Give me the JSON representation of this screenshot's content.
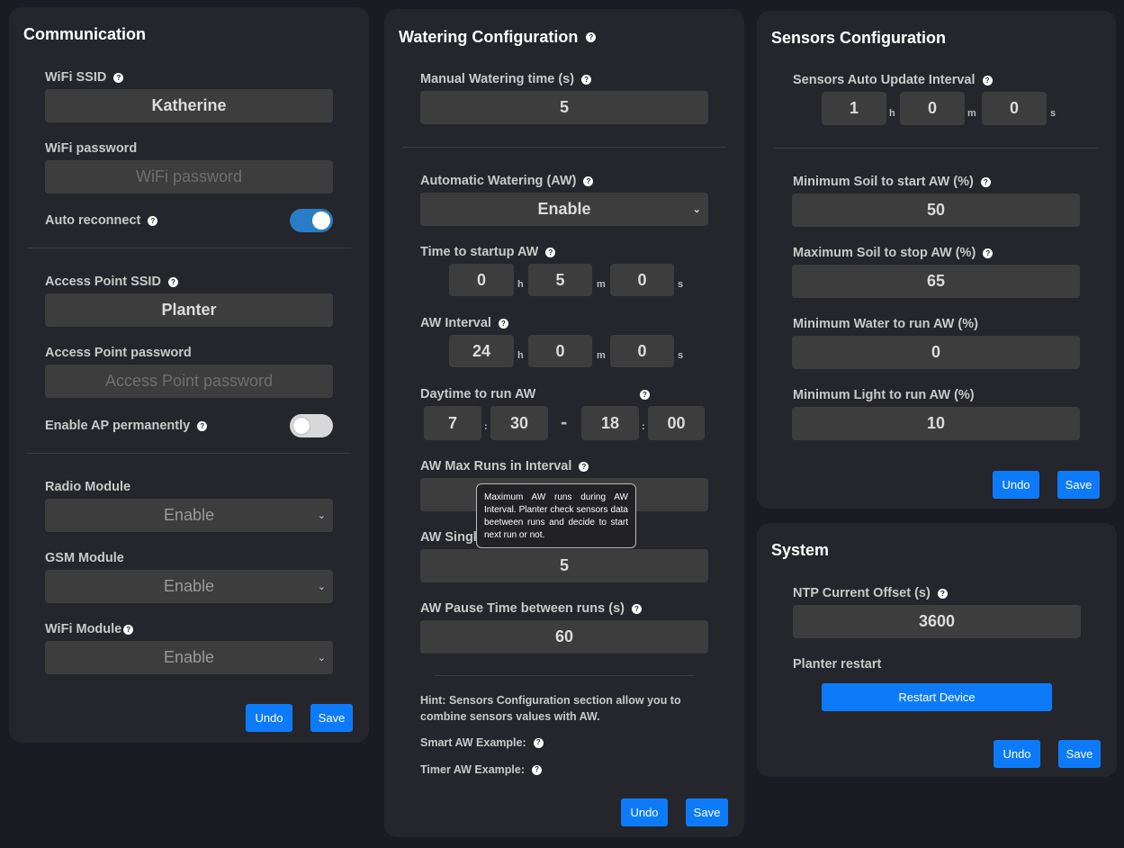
{
  "communication": {
    "title": "Communication",
    "wifi_ssid_label": "WiFi SSID",
    "wifi_ssid": "Katherine",
    "wifi_password_label": "WiFi password",
    "wifi_password_placeholder": "WiFi password",
    "auto_reconnect_label": "Auto reconnect",
    "auto_reconnect": true,
    "ap_ssid_label": "Access Point SSID",
    "ap_ssid": "Planter",
    "ap_password_label": "Access Point password",
    "ap_password_placeholder": "Access Point password",
    "enable_ap_label": "Enable AP permanently",
    "enable_ap": false,
    "radio_label": "Radio Module",
    "radio_value": "Enable",
    "gsm_label": "GSM Module",
    "gsm_value": "Enable",
    "wifi_module_label": "WiFi Module",
    "wifi_module_value": "Enable",
    "undo": "Undo",
    "save": "Save"
  },
  "watering": {
    "title": "Watering Configuration",
    "manual_label": "Manual Watering time (s)",
    "manual_value": "5",
    "aw_label": "Automatic Watering (AW)",
    "aw_value": "Enable",
    "startup_label": "Time to startup AW",
    "startup": {
      "h": "0",
      "m": "5",
      "s": "0"
    },
    "interval_label": "AW Interval",
    "interval": {
      "h": "24",
      "m": "0",
      "s": "0"
    },
    "daytime_label": "Daytime to run AW",
    "daytime": {
      "start_h": "7",
      "start_m": "30",
      "end_h": "18",
      "end_m": "00"
    },
    "max_runs_label": "AW Max Runs in Interval",
    "max_runs_tooltip": "Maximum AW runs during AW Interval. Planter check sensors data beetween runs and decide to start next run or not.",
    "single_label": "AW Singl",
    "single_value": "5",
    "pause_label": "AW Pause Time between runs (s)",
    "pause_value": "60",
    "hint_bold": "Hint:",
    "hint_text": " Sensors Configuration section allow you to combine sensors values with AW.",
    "smart_example": "Smart AW Example:",
    "timer_example": "Timer AW Example:",
    "undo": "Undo",
    "save": "Save"
  },
  "units": {
    "h": "h",
    "m": "m",
    "s": "s",
    "colon": ":",
    "dash": "-"
  },
  "sensors": {
    "title": "Sensors Configuration",
    "auto_update_label": "Sensors Auto Update Interval",
    "auto_update": {
      "h": "1",
      "m": "0",
      "s": "0"
    },
    "min_soil_label": "Minimum Soil to start AW (%)",
    "min_soil": "50",
    "max_soil_label": "Maximum Soil to stop AW (%)",
    "max_soil": "65",
    "min_water_label": "Minimum Water to run AW (%)",
    "min_water": "0",
    "min_light_label": "Minimum Light to run AW (%)",
    "min_light": "10",
    "undo": "Undo",
    "save": "Save"
  },
  "system": {
    "title": "System",
    "ntp_label": "NTP Current Offset (s)",
    "ntp_value": "3600",
    "restart_label": "Planter restart",
    "restart_button": "Restart Device",
    "undo": "Undo",
    "save": "Save"
  },
  "help_glyph": "?",
  "chevron_glyph": "⌄",
  "colors": {
    "accent": "#0d7bf9",
    "toggle_on": "#2b7cc6"
  }
}
